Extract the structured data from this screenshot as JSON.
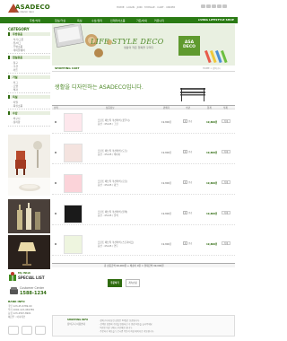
{
  "header": {
    "logo_text": "ASADECO",
    "logo_sub": "asa interior deco",
    "top_links": "HOME · LOGIN · JOIN · MYPAGE · CART · ORDER",
    "brand_color": "#2a7a14"
  },
  "nav": {
    "items": [
      "주방/식탁",
      "침실/거실",
      "욕실",
      "수납/정리",
      "인테리어소품",
      "가든/야외",
      "커뮤니티"
    ],
    "right_label": "LIVING LIFESTYLE SHOP"
  },
  "sidebar": {
    "category_title": "CATEGORY",
    "sections": [
      {
        "title": "주방용품",
        "rows": [
          "· 식기/그릇",
          "· 컵/머그",
          "· 주방소품",
          "· 테이블웨어"
        ]
      },
      {
        "title": "침실용품",
        "rows": [
          "· 침구",
          "· 쿠션",
          "· 커튼"
        ]
      },
      {
        "title": "거실",
        "rows": [
          "· 러그",
          "· 조명",
          "· 액자"
        ]
      },
      {
        "title": "욕실",
        "rows": [
          "· 타월",
          "· 욕실소품"
        ]
      },
      {
        "title": "수납",
        "rows": [
          "· 바구니",
          "· 정리함"
        ]
      }
    ],
    "wishlist_label": "My Wish",
    "wishlist_title": "SPECIAL LIST",
    "cs_label": "Customer Center",
    "cs_phone": "1588-1234",
    "bank_title": "BANK INFO",
    "bank_rows": [
      "국민 123-45-6789-00",
      "우리 1002-123-456789",
      "농협 123-4567-8901",
      "예금주 : 아사데코"
    ]
  },
  "banner": {
    "title": "LIFE STYLE DECO",
    "subtitle": "생활의 작은 행복을 꾸미다",
    "box_text": "ASA DECO"
  },
  "cart": {
    "label": "SHOPPING CART",
    "breadcrumb": "HOME > 장바구니",
    "headline": "생활을 디자인하는 ASADECO입니다.",
    "columns": [
      "선택",
      "상품정보",
      "판매가",
      "수량",
      "합계",
      "삭제"
    ],
    "items": [
      {
        "line1": "프린트 패브릭 쿠션커버 (꽃무늬)",
        "line2": "옵션 : 45x45 / 그린",
        "price": "19,800원",
        "qty": "1",
        "total": "19,800원",
        "delete": "삭제",
        "thumb": "#fde7ec"
      },
      {
        "line1": "프린트 패브릭 쿠션커버 (도트)",
        "line2": "옵션 : 45x45 / 베이지",
        "price": "19,800원",
        "qty": "1",
        "total": "19,800원",
        "delete": "삭제",
        "thumb": "#f4e3df"
      },
      {
        "line1": "프린트 패브릭 쿠션커버 (로즈)",
        "line2": "옵션 : 45x45 / 핑크",
        "price": "19,800원",
        "qty": "1",
        "total": "19,800원",
        "delete": "삭제",
        "thumb": "#fbd3d9"
      },
      {
        "line1": "프린트 패브릭 쿠션커버 (블랙)",
        "line2": "옵션 : 45x45 / 블랙",
        "price": "19,800원",
        "qty": "1",
        "total": "19,800원",
        "delete": "삭제",
        "thumb": "#1a1a1a"
      },
      {
        "line1": "프린트 패브릭 쿠션커버 (스트라이프)",
        "line2": "옵션 : 45x45 / 연두",
        "price": "19,800원",
        "qty": "1",
        "total": "19,800원",
        "delete": "삭제",
        "thumb": "#eef5df"
      }
    ],
    "qty_btn": "변경",
    "summary": "총 상품금액 99,000원 + 배송비 0원 = 결제금액 99,000원",
    "order_button": "주문하기",
    "continue_button": "계속쇼핑"
  },
  "info": {
    "title": "SHOPPING INFO",
    "title2": "장바구니 이용안내",
    "lines": [
      "· 장바구니에 담긴 상품은 30일간 보관됩니다.",
      "· 선택한 상품의 수량을 변경하신 후 변경 버튼을 눌러주세요.",
      "· 5만원 이상 구매시 무료배송 됩니다.",
      "· 주문하기 버튼을 누르시면 주문서 작성 페이지로 이동합니다."
    ]
  }
}
